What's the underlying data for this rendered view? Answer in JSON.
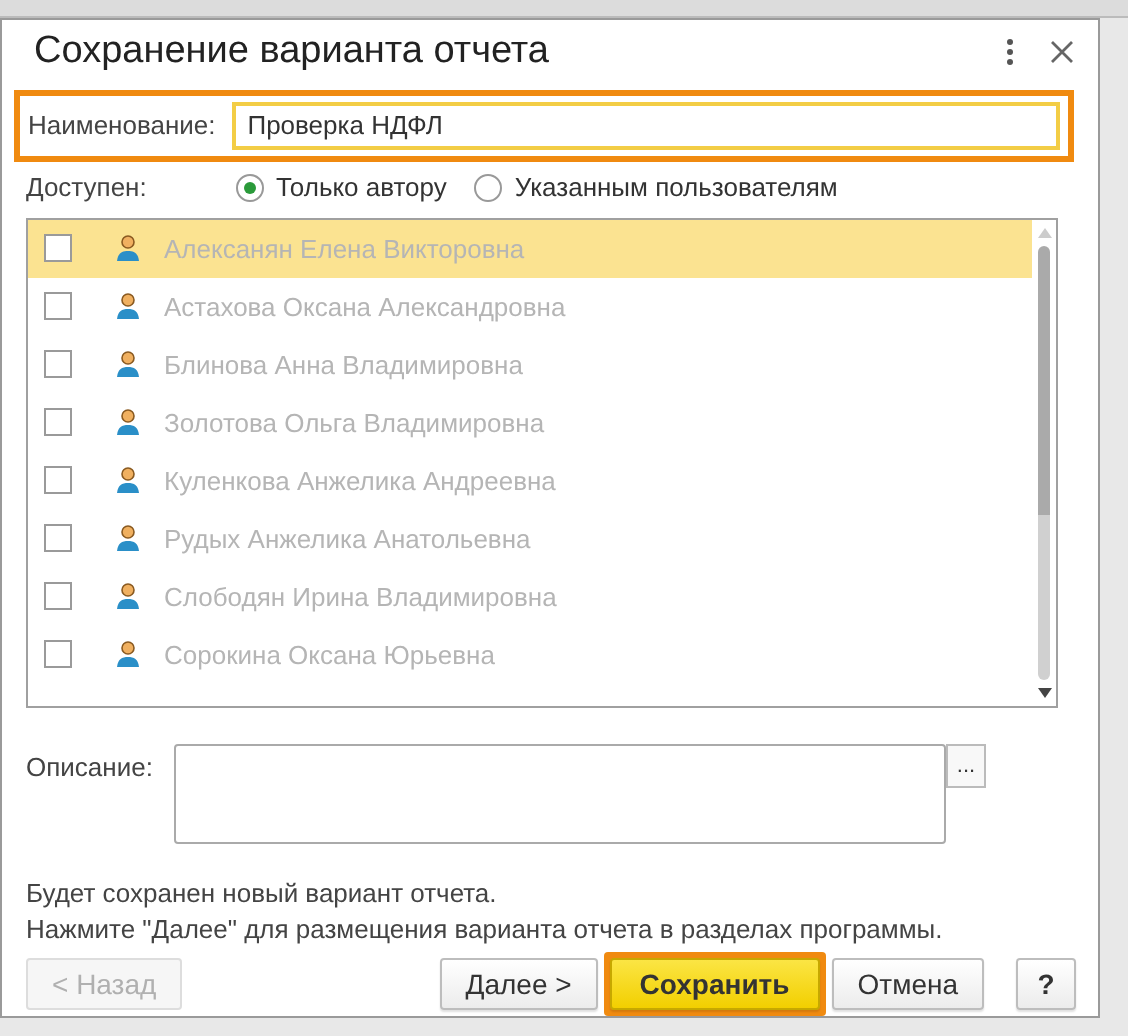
{
  "window": {
    "title": "Сохранение варианта отчета"
  },
  "name_field": {
    "label": "Наименование:",
    "value": "Проверка НДФЛ",
    "highlighted": true
  },
  "access": {
    "label": "Доступен:",
    "options": [
      {
        "label": "Только автору",
        "selected": true
      },
      {
        "label": "Указанным пользователям",
        "selected": false
      }
    ]
  },
  "users": {
    "disabled": true,
    "items": [
      {
        "name": "Алексанян Елена Викторовна",
        "checked": false,
        "selected": true
      },
      {
        "name": "Астахова Оксана Александровна",
        "checked": false,
        "selected": false
      },
      {
        "name": "Блинова Анна Владимировна",
        "checked": false,
        "selected": false
      },
      {
        "name": "Золотова Ольга Владимировна",
        "checked": false,
        "selected": false
      },
      {
        "name": "Куленкова Анжелика Андреевна",
        "checked": false,
        "selected": false
      },
      {
        "name": "Рудых Анжелика Анатольевна",
        "checked": false,
        "selected": false
      },
      {
        "name": "Слободян Ирина Владимировна",
        "checked": false,
        "selected": false
      },
      {
        "name": "Сорокина Оксана Юрьевна",
        "checked": false,
        "selected": false
      }
    ]
  },
  "description": {
    "label": "Описание:",
    "more_button": "..."
  },
  "info": [
    "Будет сохранен новый вариант отчета.",
    "Нажмите \"Далее\" для размещения варианта отчета в разделах программы."
  ],
  "buttons": [
    {
      "label": "< Назад",
      "kind": "plain",
      "disabled": true,
      "highlighted": false
    },
    {
      "label": "Далее >",
      "kind": "plain",
      "disabled": false,
      "highlighted": false
    },
    {
      "label": "Сохранить",
      "kind": "default",
      "disabled": false,
      "highlighted": true
    },
    {
      "label": "Отмена",
      "kind": "plain",
      "disabled": false,
      "highlighted": false
    },
    {
      "label": "?",
      "kind": "help",
      "disabled": false,
      "highlighted": false
    }
  ]
}
